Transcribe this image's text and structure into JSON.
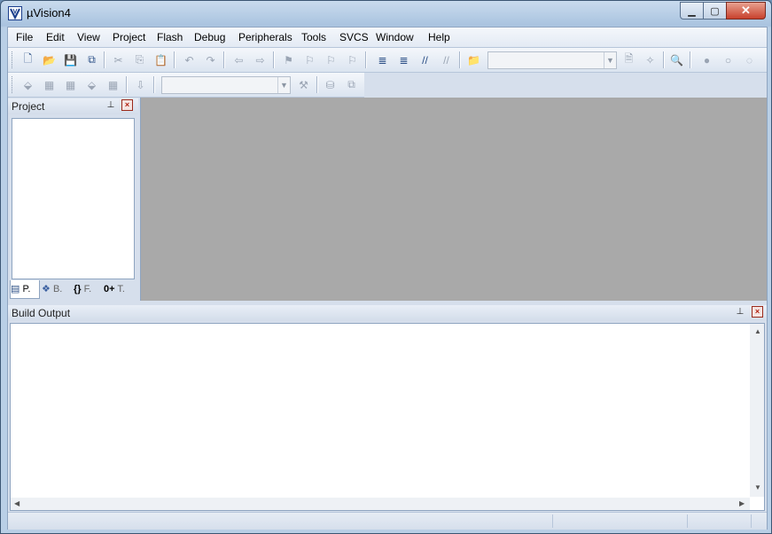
{
  "window": {
    "title": "µVision4",
    "controls": [
      "minimize",
      "maximize",
      "close"
    ]
  },
  "menu": [
    "File",
    "Edit",
    "View",
    "Project",
    "Flash",
    "Debug",
    "Peripherals",
    "Tools",
    "SVCS",
    "Window",
    "Help"
  ],
  "toolbar1": {
    "icons": [
      "new-file-icon",
      "open-folder-icon",
      "save-icon",
      "save-all-icon",
      "cut-icon",
      "copy-icon",
      "paste-icon",
      "undo-icon",
      "redo-icon",
      "nav-back-icon",
      "nav-forward-icon",
      "bookmark-insert-icon",
      "bookmark-prev-icon",
      "bookmark-next-icon",
      "bookmark-clear-icon",
      "indent-icon",
      "unindent-icon",
      "comment-icon",
      "uncomment-icon",
      "find-in-files-icon"
    ],
    "find_combo_value": "",
    "right_icons": [
      "incremental-find-icon",
      "source-browser-icon",
      "zoom-icon",
      "start-debug-icon",
      "insert-breakpoint-icon",
      "breakpoints-icon"
    ]
  },
  "toolbar2": {
    "icons": [
      "translate-icon",
      "build-icon",
      "rebuild-icon",
      "batch-build-icon",
      "stop-build-icon",
      "download-icon"
    ],
    "target_combo_value": "",
    "right_icons": [
      "target-options-icon",
      "manage-components-icon",
      "select-packet-icon"
    ]
  },
  "project_panel": {
    "title": "Project",
    "pin_glyph": "⊥",
    "close_glyph": "×",
    "tabs": [
      {
        "label": "P.",
        "icon": "project-tab-icon",
        "active": true
      },
      {
        "label": "B.",
        "icon": "books-tab-icon",
        "active": false
      },
      {
        "label": "F.",
        "icon": "functions-tab-icon",
        "glyph": "{}",
        "active": false
      },
      {
        "label": "T.",
        "icon": "templates-tab-icon",
        "glyph": "0+",
        "active": false
      }
    ]
  },
  "build_output": {
    "title": "Build Output",
    "text": ""
  },
  "status": {
    "cells": [
      "",
      "",
      ""
    ]
  },
  "colors": {
    "editor_bg": "#a9a9a9",
    "title_gradient_top": "#c9dbee",
    "close_button": "#c8412d"
  }
}
